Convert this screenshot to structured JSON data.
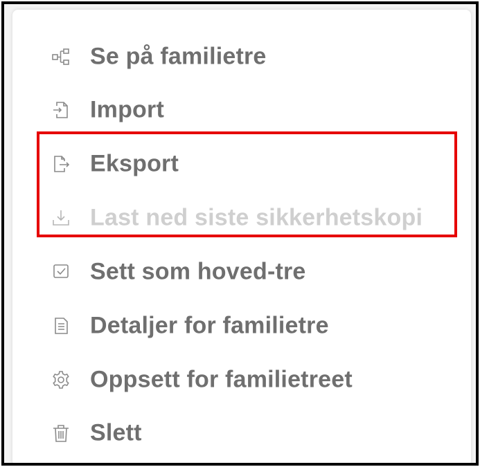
{
  "menu": {
    "items": [
      {
        "label": "Se på familietre",
        "icon": "family-tree-icon",
        "enabled": true
      },
      {
        "label": "Import",
        "icon": "import-icon",
        "enabled": true
      },
      {
        "label": "Eksport",
        "icon": "export-icon",
        "enabled": true
      },
      {
        "label": "Last ned siste sikkerhetskopi",
        "icon": "download-icon",
        "enabled": false
      },
      {
        "label": "Sett som hoved-tre",
        "icon": "checkbox-icon",
        "enabled": true
      },
      {
        "label": "Detaljer for familietre",
        "icon": "details-icon",
        "enabled": true
      },
      {
        "label": "Oppsett for familietreet",
        "icon": "gear-icon",
        "enabled": true
      },
      {
        "label": "Slett",
        "icon": "trash-icon",
        "enabled": true
      }
    ]
  },
  "colors": {
    "text": "#6f6f6f",
    "disabled_text": "#cfcfcf",
    "highlight": "#e60000",
    "frame_border": "#000000"
  }
}
